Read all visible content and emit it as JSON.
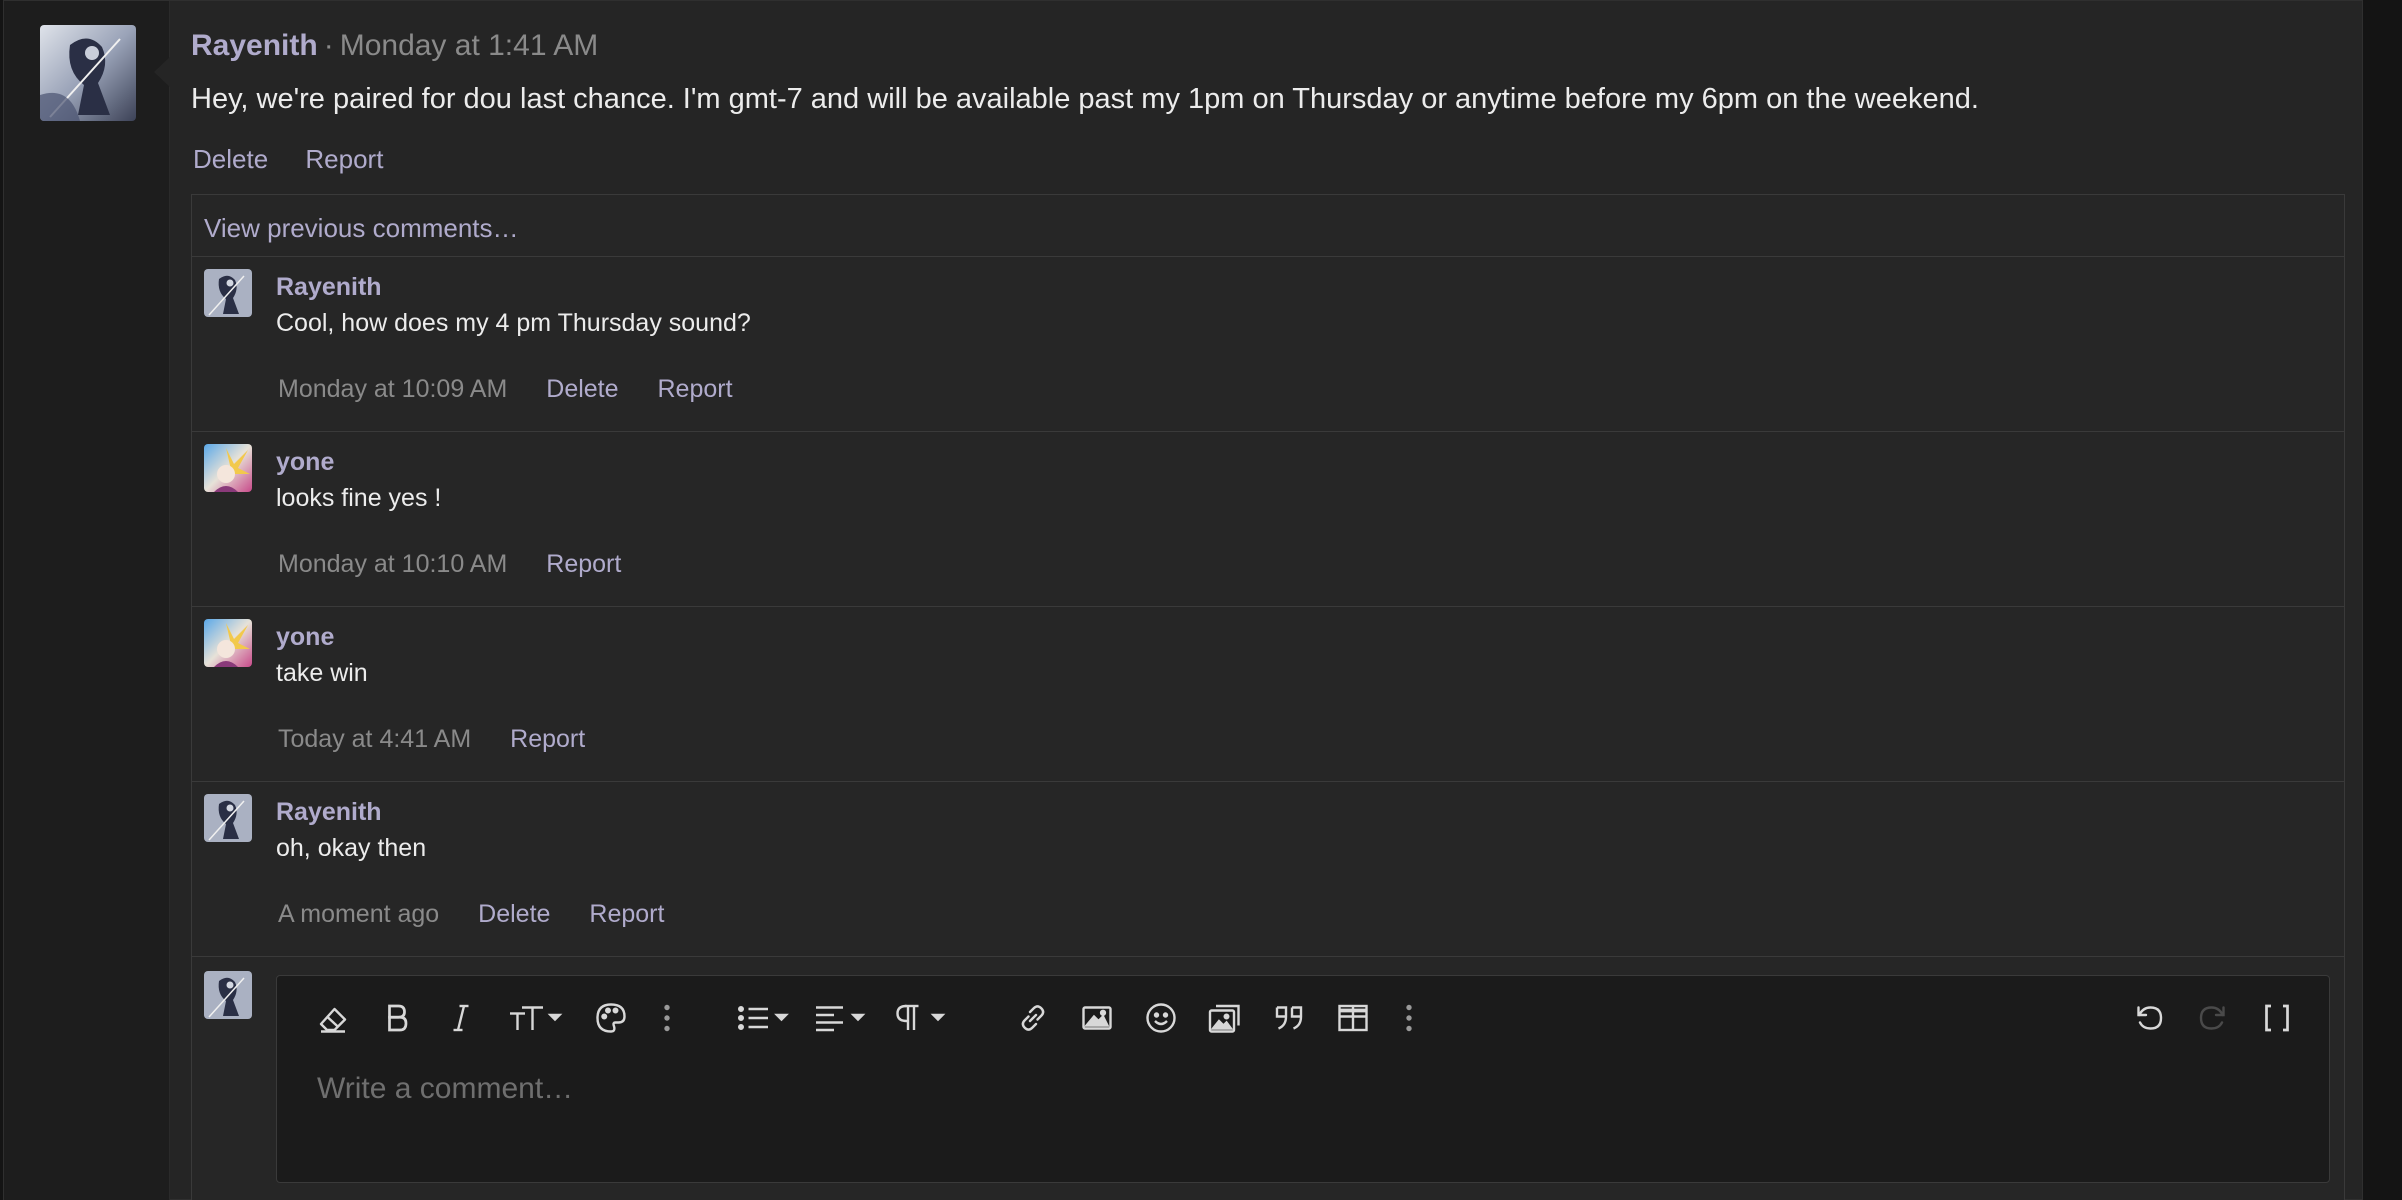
{
  "post": {
    "author": "Rayenith",
    "separator": "·",
    "timestamp": "Monday at 1:41 AM",
    "body": "Hey, we're paired for dou last chance. I'm gmt-7 and will be available past my 1pm on Thursday or anytime before my 6pm on the weekend.",
    "actions": [
      "Delete",
      "Report"
    ]
  },
  "comments": {
    "view_previous": "View previous comments…",
    "items": [
      {
        "author": "Rayenith",
        "text": "Cool, how does my 4 pm Thursday sound?",
        "time": "Monday at 10:09 AM",
        "actions": [
          "Delete",
          "Report"
        ]
      },
      {
        "author": "yone",
        "text": "looks fine yes !",
        "time": "Monday at 10:10 AM",
        "actions": [
          "Report"
        ]
      },
      {
        "author": "yone",
        "text": "take win",
        "time": "Today at 4:41 AM",
        "actions": [
          "Report"
        ]
      },
      {
        "author": "Rayenith",
        "text": "oh, okay then",
        "time": "A moment ago",
        "actions": [
          "Delete",
          "Report"
        ]
      }
    ]
  },
  "editor": {
    "placeholder": "Write a comment…",
    "toolbar": [
      "eraser-icon",
      "bold-icon",
      "italic-icon",
      "text-size-icon",
      "palette-icon",
      "more-vertical-icon",
      "list-icon",
      "align-icon",
      "paragraph-icon",
      "link-icon",
      "image-icon",
      "smiley-icon",
      "media-icon",
      "quote-icon",
      "table-icon",
      "more-vertical-icon",
      "undo-icon",
      "redo-icon",
      "bbcode-toggle-icon"
    ]
  },
  "colors": {
    "link": "#b0abcc",
    "text": "#ececec",
    "muted": "#8a8a8a",
    "card": "#252525",
    "editor": "#1b1b1b"
  }
}
